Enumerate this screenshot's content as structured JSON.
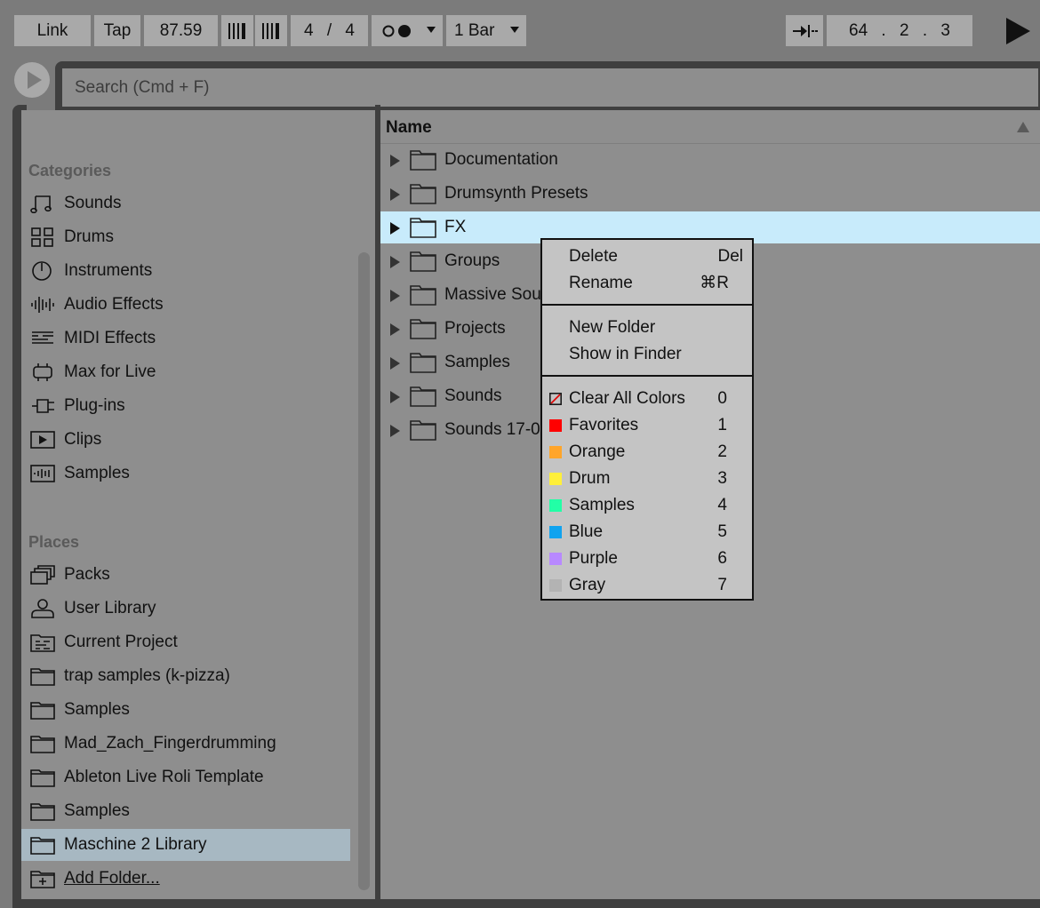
{
  "transport": {
    "link": "Link",
    "tap": "Tap",
    "tempo": "87.59",
    "sig_num": "4",
    "sig_sep": "/",
    "sig_den": "4",
    "quantize": "1 Bar",
    "pos_bar": "64",
    "pos_beat": "2",
    "pos_sixteenth": "3",
    "pos_sep": "."
  },
  "search": {
    "placeholder": "Search (Cmd + F)"
  },
  "sidebar": {
    "categories_title": "Categories",
    "categories": [
      {
        "label": "Sounds",
        "icon": "note-icon"
      },
      {
        "label": "Drums",
        "icon": "grid-icon"
      },
      {
        "label": "Instruments",
        "icon": "power-knob-icon"
      },
      {
        "label": "Audio Effects",
        "icon": "waveform-icon"
      },
      {
        "label": "MIDI Effects",
        "icon": "midi-lines-icon"
      },
      {
        "label": "Max for Live",
        "icon": "max-device-icon"
      },
      {
        "label": "Plug-ins",
        "icon": "plug-icon"
      },
      {
        "label": "Clips",
        "icon": "clip-play-icon"
      },
      {
        "label": "Samples",
        "icon": "sample-wave-icon"
      }
    ],
    "places_title": "Places",
    "places": [
      {
        "label": "Packs",
        "icon": "packs-icon"
      },
      {
        "label": "User Library",
        "icon": "user-icon"
      },
      {
        "label": "Current Project",
        "icon": "project-folder-icon"
      },
      {
        "label": "trap samples (k-pizza)",
        "icon": "folder-icon"
      },
      {
        "label": "Samples",
        "icon": "folder-icon"
      },
      {
        "label": "Mad_Zach_Fingerdrumming",
        "icon": "folder-icon"
      },
      {
        "label": "Ableton Live Roli Template",
        "icon": "folder-icon"
      },
      {
        "label": "Samples",
        "icon": "folder-icon"
      },
      {
        "label": "Maschine 2 Library",
        "icon": "folder-icon",
        "selected": true
      },
      {
        "label": "Add Folder...",
        "icon": "add-folder-icon"
      }
    ]
  },
  "browser": {
    "column_header": "Name",
    "rows": [
      {
        "name": "Documentation"
      },
      {
        "name": "Drumsynth Presets"
      },
      {
        "name": "FX",
        "selected": true
      },
      {
        "name": "Groups"
      },
      {
        "name": "Massive Sou"
      },
      {
        "name": "Projects"
      },
      {
        "name": "Samples"
      },
      {
        "name": "Sounds"
      },
      {
        "name": "Sounds 17-0"
      }
    ]
  },
  "context_menu": {
    "delete": "Delete",
    "delete_shortcut": "Del",
    "rename": "Rename",
    "rename_shortcut": "⌘R",
    "new_folder": "New Folder",
    "show_in_finder": "Show in Finder",
    "colors": [
      {
        "label": "Clear All Colors",
        "key": "0",
        "color": "none"
      },
      {
        "label": "Favorites",
        "key": "1",
        "color": "#ff0000"
      },
      {
        "label": "Orange",
        "key": "2",
        "color": "#ffa52a"
      },
      {
        "label": "Drum",
        "key": "3",
        "color": "#ffef3a"
      },
      {
        "label": "Samples",
        "key": "4",
        "color": "#22ffa6"
      },
      {
        "label": "Blue",
        "key": "5",
        "color": "#10a3ef"
      },
      {
        "label": "Purple",
        "key": "6",
        "color": "#b889ff"
      },
      {
        "label": "Gray",
        "key": "7",
        "color": "#b3b3b3"
      }
    ]
  },
  "theme": {
    "background": "#7b7b7b",
    "panel": "#8e8e8e",
    "selection_list": "#c8ebfb",
    "selection_sidebar": "#a7b8c2",
    "menu": "#c4c4c4"
  }
}
